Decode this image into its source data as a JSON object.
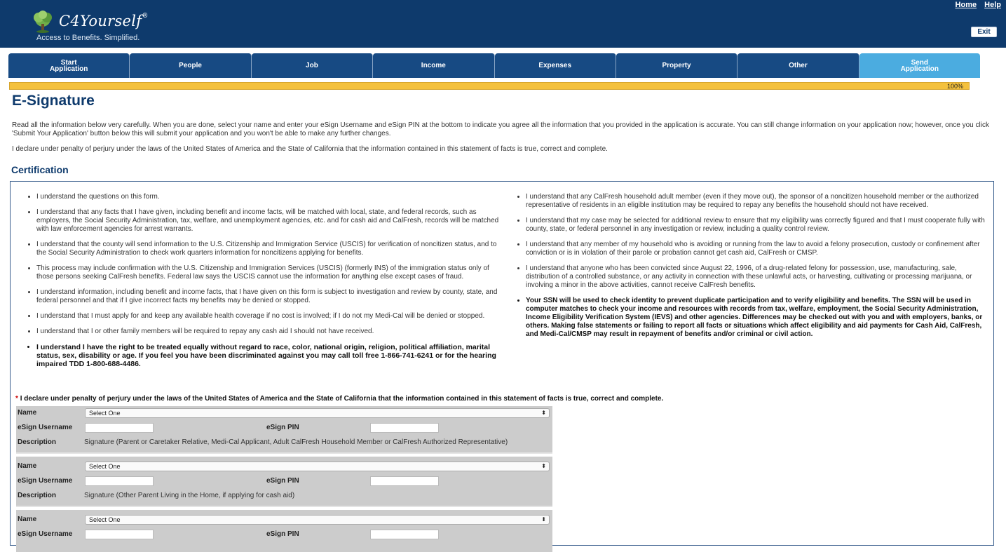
{
  "header": {
    "brand": "C4Yourself",
    "registered": "®",
    "tagline": "Access to Benefits.  Simplified.",
    "links": [
      "Home",
      "Help"
    ],
    "exit_label": "Exit",
    "colors": {
      "header_bg": "#0e3a6c",
      "tab_bg": "#174a83",
      "tab_active_bg": "#4bace0",
      "progress": "#f4c13d"
    }
  },
  "tabs": [
    {
      "label": "Start\nApplication"
    },
    {
      "label": "People"
    },
    {
      "label": "Job"
    },
    {
      "label": "Income"
    },
    {
      "label": "Expenses"
    },
    {
      "label": "Property"
    },
    {
      "label": "Other"
    },
    {
      "label": "Send\nApplication",
      "active": true
    }
  ],
  "progress": {
    "value": 1.0,
    "label": "100%"
  },
  "page_title": "E-Signature",
  "intro": "Read all the information below very carefully. When you are done, select your name and enter your eSign Username and eSign PIN at the bottom to indicate you agree all the information that you provided in the application is accurate. You can still change information on your application now; however, once you click 'Submit Your Application' button below this will submit your application and you won't be able to make any further changes.",
  "declaration": "I declare under penalty of perjury under the laws of the United States of America and the State of California that the information contained in this statement of facts is true, correct and complete.",
  "certification": {
    "title": "Certification",
    "left_items": [
      "I understand the questions on this form.",
      "I understand that any facts that I have given, including benefit and income facts, will be matched with local, state, and federal records, such as employers, the Social Security Administration, tax, welfare, and unemployment agencies, etc. and for cash aid and CalFresh, records will be matched with law enforcement agencies for arrest warrants.",
      "I understand that the county will send information to the U.S. Citizenship and Immigration Service (USCIS) for verification of noncitizen status, and to the Social Security Administration to check work quarters information for noncitizens applying for benefits.",
      "This process may include confirmation with the U.S. Citizenship and Immigration Services (USCIS) (formerly INS) of the immigration status only of those persons seeking CalFresh benefits. Federal law says the USCIS cannot use the information for anything else except cases of fraud.",
      "I understand information, including benefit and income facts, that I have given on this form is subject to investigation and review by county, state, and federal personnel and that if I give incorrect facts my benefits may be denied or stopped.",
      "I understand that I must apply for and keep any available health coverage if no cost is involved; if I do not my Medi-Cal will be denied or stopped.",
      "I understand that I or other family members will be required to repay any cash aid I should not have received.",
      "I understand I have the right to be treated equally without regard to race, color, national origin, religion, political affiliation, marital status, sex, disability or age. If you feel you have been discriminated against you may call toll free 1-866-741-6241 or for the hearing impaired TDD 1-800-688-4486."
    ],
    "right_items": [
      "I understand that any CalFresh household adult member (even if they move out), the sponsor of a noncitizen household member or the authorized representative of residents in an eligible institution may be required to repay any benefits the household should not have received.",
      "I understand that my case may be selected for additional review to ensure that my eligibility was correctly figured and that I must cooperate fully with county, state, or federal personnel in any investigation or review, including a quality control review.",
      "I understand that any member of my household who is avoiding or running from the law to avoid a felony prosecution, custody or confinement after conviction or is in violation of their parole or probation cannot get cash aid, CalFresh or CMSP.",
      "I understand that anyone who has been convicted since August 22, 1996, of a drug-related felony for possession, use, manufacturing, sale, distribution of a controlled substance, or any activity in connection with these unlawful acts, or harvesting, cultivating or processing marijuana, or involving a minor in the above activities, cannot receive CalFresh benefits.",
      "Your SSN will be used to check identity to prevent duplicate participation and to verify eligibility and benefits. The SSN will be used in computer matches to check your income and resources with records from tax, welfare, employment, the Social Security Administration, Income Eligibility Verification System (IEVS) and other agencies. Differences may be checked out with you and with employers, banks, or others. Making false statements or failing to report all facts or situations which affect eligibility and aid payments for Cash Aid, CalFresh, and Medi-Cal/CMSP may result in repayment of benefits and/or criminal or civil action."
    ]
  },
  "signature_form": {
    "required_marker": "*",
    "declaration": "I declare under penalty of perjury under the laws of the United States of America and the State of California that the information contained in this statement of facts is true, correct and complete.",
    "name_label": "Name",
    "username_label": "eSign Username",
    "pin_label": "eSign PIN",
    "description_label": "Description",
    "select_placeholder": "Select One",
    "blocks": [
      {
        "description": "Signature (Parent or Caretaker Relative, Medi-Cal Applicant, Adult CalFresh Household Member or CalFresh Authorized Representative)"
      },
      {
        "description": "Signature (Other Parent Living in the Home, if applying for cash aid)"
      },
      {
        "description": ""
      }
    ]
  }
}
